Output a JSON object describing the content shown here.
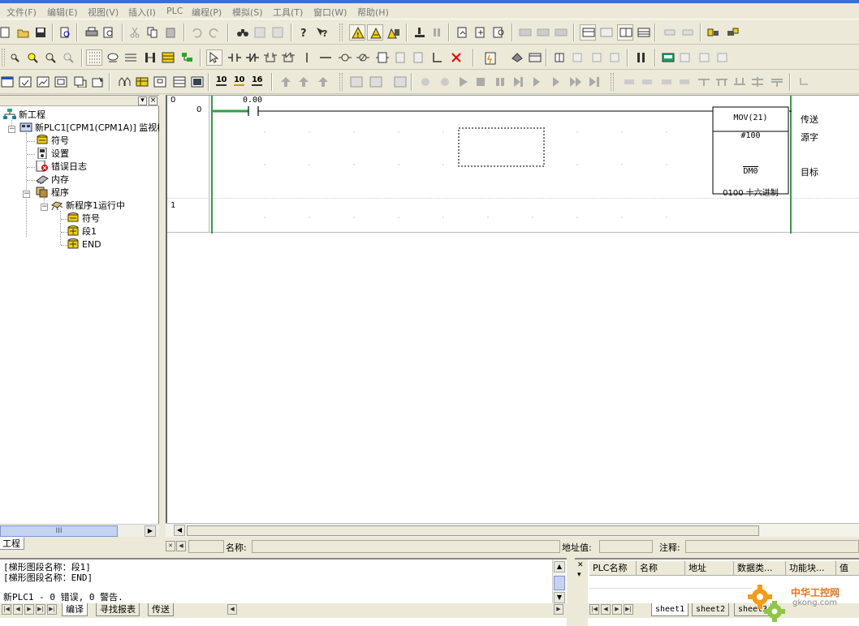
{
  "menu": [
    "文件(F)",
    "编辑(E)",
    "视图(V)",
    "插入(I)",
    "PLC",
    "编程(P)",
    "模拟(S)",
    "工具(T)",
    "窗口(W)",
    "帮助(H)"
  ],
  "toolbar": {
    "number_buttons": [
      "10",
      "10",
      "16"
    ]
  },
  "tree": {
    "root": "新工程",
    "plc": "新PLC1[CPM1(CPM1A)] 监视模式",
    "symbols": "符号",
    "settings": "设置",
    "error_log": "错误日志",
    "memory": "内存",
    "programs": "程序",
    "program1": "新程序1运行中",
    "prog_symbols": "符号",
    "section1": "段1",
    "end": "END",
    "tab_label": "工程",
    "scroll_mark": "III"
  },
  "ladder": {
    "rungs": [
      {
        "step_label": "0",
        "address_label": "0"
      },
      {
        "step_label": "1"
      }
    ],
    "contact_address": "0.00",
    "instruction": {
      "mnemonic": "MOV(21)",
      "operand1": "#100",
      "operand2": "DM0",
      "value_line": "0100 十六进制"
    },
    "comments": {
      "instruction": "传送",
      "source": "源字",
      "dest": "目标"
    }
  },
  "statusbar": {
    "name_label": "名称:",
    "address_label": "地址值:",
    "comment_label": "注释:"
  },
  "output": {
    "lines": [
      "[梯形图段名称：段1]",
      "[梯形图段名称：END]",
      "",
      "新PLC1 - 0 错误, 0 警告."
    ],
    "tabs": [
      "编译",
      "寻找报表",
      "传送"
    ]
  },
  "watch": {
    "columns": [
      "PLC名称",
      "名称",
      "地址",
      "数据类...",
      "功能块...",
      "值"
    ],
    "tabs": [
      "sheet1",
      "sheet2",
      "sheet3"
    ]
  },
  "watermark": {
    "brand": "中华工控网",
    "url": "gkong.com"
  }
}
